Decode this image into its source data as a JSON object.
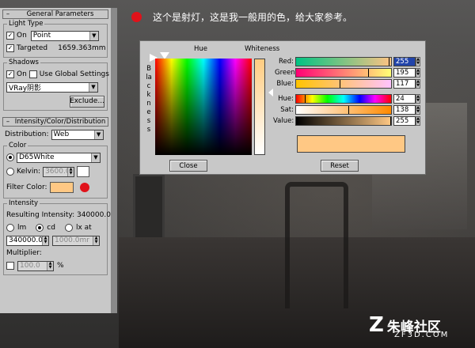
{
  "note": {
    "text": "这个是射灯，这是我一般用的色，给大家参考。",
    "dot_color": "#e0121a"
  },
  "general": {
    "title": "General Parameters",
    "light_type_label": "Light Type",
    "on_label": "On",
    "type_value": "Point",
    "targeted_label": "Targeted",
    "targeted_distance": "1659.363mm",
    "shadows_label": "Shadows",
    "shadows_on_label": "On",
    "global_label": "Use Global Settings",
    "shadow_type": "VRay阴影",
    "exclude_label": "Exclude..."
  },
  "intensity": {
    "title": "Intensity/Color/Distribution",
    "distribution_label": "Distribution:",
    "distribution_value": "Web",
    "color_label": "Color",
    "preset_value": "D65White",
    "kelvin_label": "Kelvin:",
    "kelvin_value": "3600.0",
    "filter_label": "Filter Color:",
    "filter_color": "#ffc884",
    "group_label": "Intensity",
    "resulting": "Resulting Intensity: 340000.0",
    "unit_lm": "lm",
    "unit_cd": "cd",
    "unit_lx": "lx at",
    "value": "340000.0",
    "distance": "1000.0mr",
    "multiplier_label": "Multiplier:",
    "multiplier_value": "100.0",
    "percent": "%"
  },
  "dialog": {
    "hue_label": "Hue",
    "whiteness_label": "Whiteness",
    "blackness_label": "Blackness",
    "red_label": "Red:",
    "red_value": "255",
    "green_label": "Green:",
    "green_value": "195",
    "blue_label": "Blue:",
    "blue_value": "117",
    "hue2_label": "Hue:",
    "hue_value": "24",
    "sat_label": "Sat:",
    "sat_value": "138",
    "val_label": "Value:",
    "val_value": "255",
    "close_label": "Close",
    "reset_label": "Reset"
  },
  "logo": {
    "mark": "Z",
    "name": "朱峰社区",
    "url": "ZF3D.COM"
  }
}
